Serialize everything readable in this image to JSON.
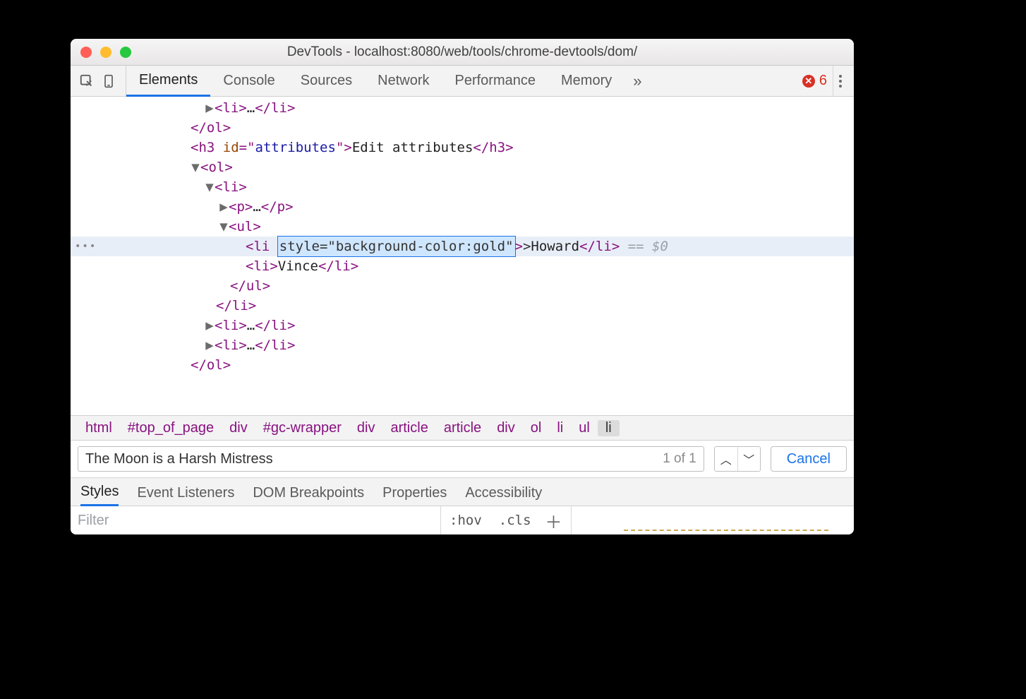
{
  "window_title": "DevTools - localhost:8080/web/tools/chrome-devtools/dom/",
  "toolbar": {
    "tabs": [
      "Elements",
      "Console",
      "Sources",
      "Network",
      "Performance",
      "Memory"
    ],
    "active_tab_index": 0,
    "overflow_glyph": "»",
    "error_count": "6"
  },
  "dom": {
    "lines": [
      {
        "indent": 190,
        "toggle": "▶",
        "html": "<span class='tagp'>&lt;li&gt;</span><span class='txt'>…</span><span class='tagp'>&lt;/li&gt;</span>"
      },
      {
        "indent": 170,
        "html": "<span class='tagp'>&lt;/ol&gt;</span>"
      },
      {
        "indent": 170,
        "html": "<span class='tagp'>&lt;h3 </span><span class='attrn'>id</span><span class='tagp'>=\"</span><span class='attrv'>attributes</span><span class='tagp'>\"&gt;</span><span class='txt'>Edit attributes</span><span class='tagp'>&lt;/h3&gt;</span>"
      },
      {
        "indent": 170,
        "toggle": "▼",
        "html": "<span class='tagp'>&lt;ol&gt;</span>"
      },
      {
        "indent": 190,
        "toggle": "▼",
        "html": "<span class='tagp'>&lt;li&gt;</span>"
      },
      {
        "indent": 210,
        "toggle": "▶",
        "html": "<span class='tagp'>&lt;p&gt;</span><span class='txt'>…</span><span class='tagp'>&lt;/p&gt;</span>"
      },
      {
        "indent": 210,
        "toggle": "▼",
        "html": "<span class='tagp'>&lt;ul&gt;</span>"
      }
    ],
    "highlighted": {
      "indent": 248,
      "before_tag": "<li",
      "edit_value": "style=\"background-color:gold\"",
      "after": "><span class='txt'>Howard</span><span class='tagp'>&lt;/li&gt;</span>",
      "suffix": " == $0"
    },
    "after_lines": [
      {
        "indent": 248,
        "html": "<span class='tagp'>&lt;li&gt;</span><span class='txt'>Vince</span><span class='tagp'>&lt;/li&gt;</span>"
      },
      {
        "indent": 226,
        "html": "<span class='tagp'>&lt;/ul&gt;</span>"
      },
      {
        "indent": 206,
        "html": "<span class='tagp'>&lt;/li&gt;</span>"
      },
      {
        "indent": 190,
        "toggle": "▶",
        "html": "<span class='tagp'>&lt;li&gt;</span><span class='txt'>…</span><span class='tagp'>&lt;/li&gt;</span>"
      },
      {
        "indent": 190,
        "toggle": "▶",
        "html": "<span class='tagp'>&lt;li&gt;</span><span class='txt'>…</span><span class='tagp'>&lt;/li&gt;</span>"
      },
      {
        "indent": 170,
        "html": "<span class='tagp'>&lt;/ol&gt;</span>"
      }
    ]
  },
  "breadcrumbs": [
    "html",
    "#top_of_page",
    "div",
    "#gc-wrapper",
    "div",
    "article",
    "article",
    "div",
    "ol",
    "li",
    "ul",
    "li"
  ],
  "breadcrumb_selected_index": 11,
  "search": {
    "value": "The Moon is a Harsh Mistress",
    "result_count": "1 of 1",
    "cancel_label": "Cancel"
  },
  "subtabs": [
    "Styles",
    "Event Listeners",
    "DOM Breakpoints",
    "Properties",
    "Accessibility"
  ],
  "subtab_active_index": 0,
  "styles_panel": {
    "filter_placeholder": "Filter",
    "hov_label": ":hov",
    "cls_label": ".cls"
  }
}
